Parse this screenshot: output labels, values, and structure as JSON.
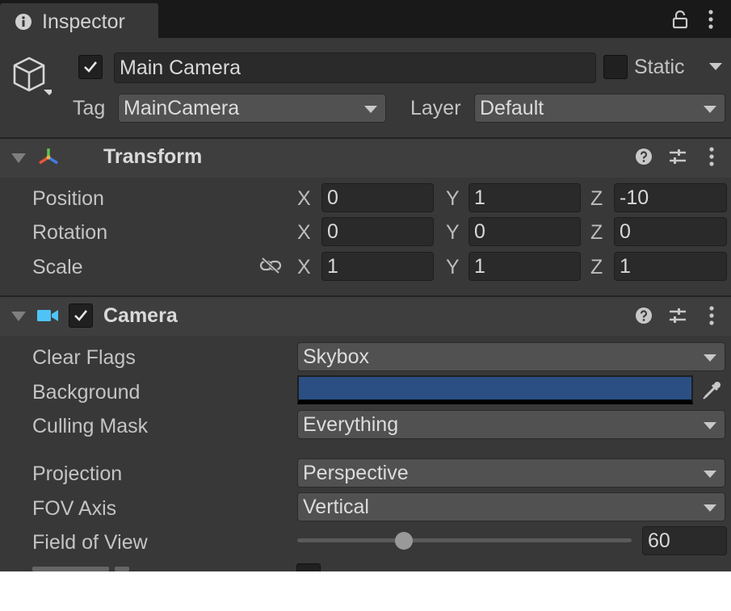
{
  "tab": {
    "title": "Inspector"
  },
  "header": {
    "object_name": "Main Camera",
    "active": true,
    "static_label": "Static",
    "tag_label": "Tag",
    "tag_value": "MainCamera",
    "layer_label": "Layer",
    "layer_value": "Default"
  },
  "transform": {
    "title": "Transform",
    "position_label": "Position",
    "rotation_label": "Rotation",
    "scale_label": "Scale",
    "axes": {
      "x": "X",
      "y": "Y",
      "z": "Z"
    },
    "position": {
      "x": "0",
      "y": "1",
      "z": "-10"
    },
    "rotation": {
      "x": "0",
      "y": "0",
      "z": "0"
    },
    "scale": {
      "x": "1",
      "y": "1",
      "z": "1"
    }
  },
  "camera": {
    "title": "Camera",
    "enabled": true,
    "clear_flags_label": "Clear Flags",
    "clear_flags_value": "Skybox",
    "background_label": "Background",
    "background_color": "#2b4f83",
    "culling_mask_label": "Culling Mask",
    "culling_mask_value": "Everything",
    "projection_label": "Projection",
    "projection_value": "Perspective",
    "fov_axis_label": "FOV Axis",
    "fov_axis_value": "Vertical",
    "fov_label": "Field of View",
    "fov_value": "60",
    "fov_slider_fraction": 0.32
  },
  "icons": [
    "info-icon",
    "lock-icon",
    "kebab-menu-icon",
    "gameobject-cube-icon",
    "transform-axes-icon",
    "camera-icon",
    "help-icon",
    "preset-sliders-icon",
    "unlink-icon",
    "eyedropper-icon"
  ]
}
